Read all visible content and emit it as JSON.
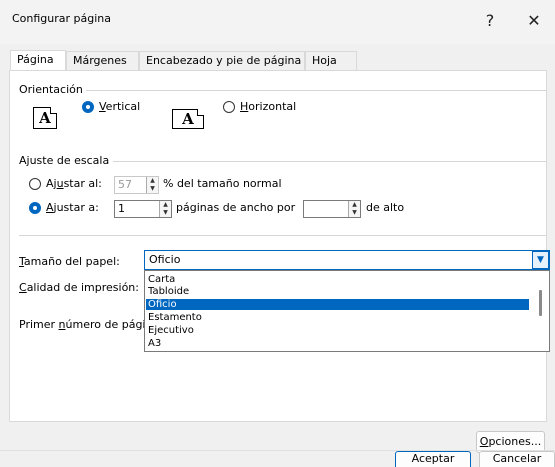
{
  "window": {
    "title": "Configurar página",
    "help_label": "?",
    "close_label": "✕"
  },
  "tabs": [
    {
      "label": "Página"
    },
    {
      "label": "Márgenes"
    },
    {
      "label": "Encabezado y pie de página"
    },
    {
      "label": "Hoja"
    }
  ],
  "orientation": {
    "section_label": "Orientación",
    "page_glyph": "A",
    "vertical": {
      "label_pre": "",
      "label_key": "V",
      "label_post": "ertical",
      "selected": true
    },
    "horizontal": {
      "label_pre": "",
      "label_key": "H",
      "label_post": "orizontal",
      "selected": false
    }
  },
  "scaling": {
    "section_label": "Ajuste de escala",
    "adjust_to": {
      "label_pre": "Aj",
      "label_key": "u",
      "label_post": "star al:",
      "value": "57",
      "suffix": "% del tamaño normal",
      "selected": false
    },
    "fit_to": {
      "label_pre": "",
      "label_key": "A",
      "label_post": "justar a:",
      "value": "1",
      "mid": "páginas de ancho por",
      "value2": "",
      "suffix": "de alto",
      "selected": true
    }
  },
  "paper": {
    "size_label_key": "T",
    "size_label_post": "amaño del papel:",
    "size_value": "Oficio",
    "quality_label_key": "C",
    "quality_label_post": "alidad de impresión:",
    "first_page_label_pre": "Primer ",
    "first_page_label_key": "n",
    "first_page_label_post": "úmero de págin",
    "options": [
      "Carta",
      "Tabloide",
      "Oficio",
      "Estamento",
      "Ejecutivo",
      "A3"
    ],
    "selected_index": 2
  },
  "buttons": {
    "options_key": "O",
    "options_post": "pciones...",
    "ok": "Aceptar",
    "cancel": "Cancelar"
  },
  "colors": {
    "accent": "#0067c0",
    "selection": "#0067c0"
  }
}
